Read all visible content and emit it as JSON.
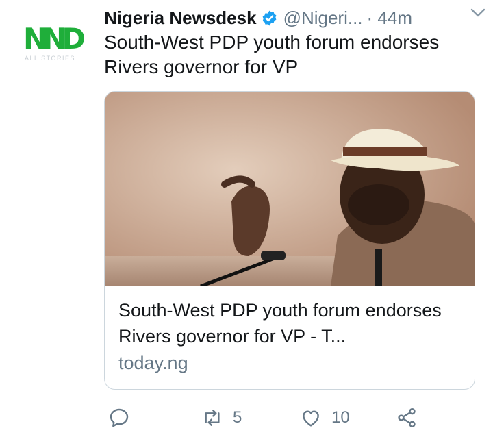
{
  "author": {
    "avatar_text": "NND",
    "avatar_subtext": "ALL STORIES",
    "name": "Nigeria Newsdesk",
    "handle": "@Nigeri...",
    "time": "· 44m",
    "verified": true
  },
  "tweet": {
    "text": "South-West PDP youth forum endorses Rivers governor for VP"
  },
  "card": {
    "title": "South-West PDP youth forum endorses Rivers governor for VP - T...",
    "domain": "today.ng"
  },
  "actions": {
    "reply_count": "",
    "retweet_count": "5",
    "like_count": "10"
  },
  "colors": {
    "brand_green": "#1fae3a",
    "verified_blue": "#1da1f2",
    "muted_gray": "#657786",
    "border": "#ccd6dd"
  },
  "icons": [
    "verified-badge-icon",
    "chevron-down-icon",
    "reply-icon",
    "retweet-icon",
    "like-icon",
    "share-icon"
  ]
}
